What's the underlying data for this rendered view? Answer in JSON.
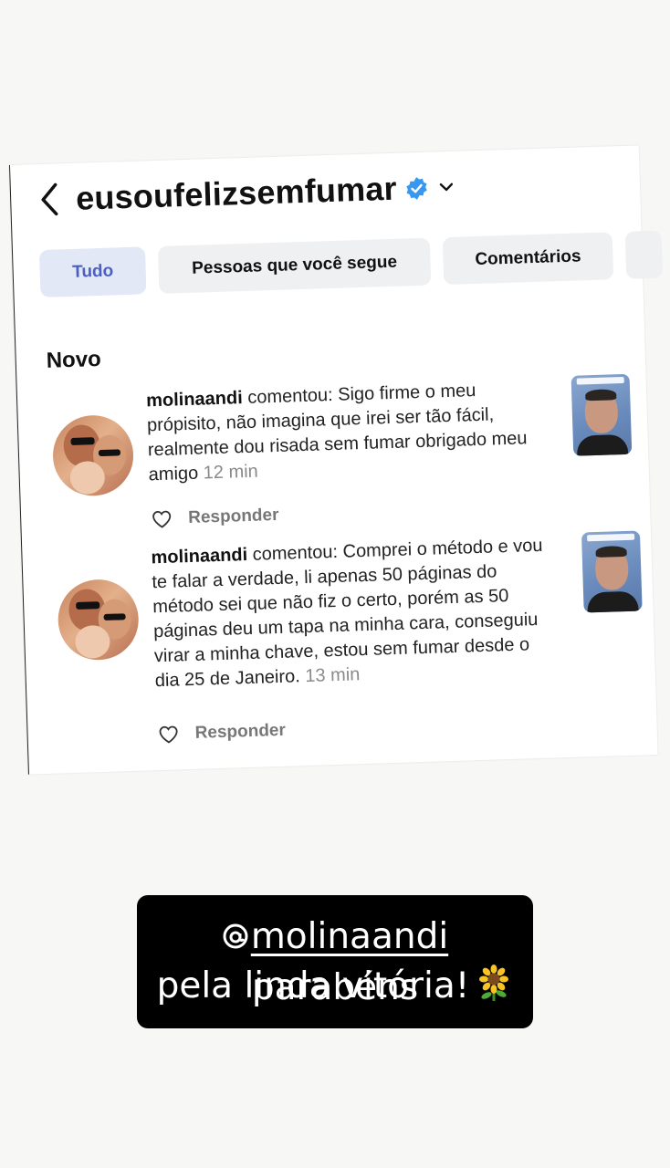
{
  "header": {
    "username": "eusoufelizsemfumar"
  },
  "tabs": [
    {
      "label": "Tudo"
    },
    {
      "label": "Pessoas que você segue"
    },
    {
      "label": "Comentários"
    }
  ],
  "section_title": "Novo",
  "notifications": [
    {
      "user": "molinaandi",
      "text": " comentou: Sigo firme o meu própisito, não imagina que irei ser tão fácil, realmente dou risada sem fumar obrigado meu amigo ",
      "time": "12 min",
      "reply_label": "Responder"
    },
    {
      "user": "molinaandi",
      "text": " comentou: Comprei o método e vou te falar a verdade, li apenas 50 páginas do método sei que não fiz o certo, porém as 50 páginas deu um tapa na minha cara, conseguiu virar a minha chave, estou sem fumar desde o dia 25 de Janeiro. ",
      "time": "13 min",
      "reply_label": "Responder"
    }
  ],
  "caption": {
    "mention": "molinaandi",
    "line1_rest": " parabéns",
    "line2": "pela linda vitória!"
  },
  "colors": {
    "verified": "#3897f0",
    "active_tab_text": "#4a5fc1",
    "active_tab_bg": "#e3e8f7",
    "caption_bg": "#000000"
  }
}
